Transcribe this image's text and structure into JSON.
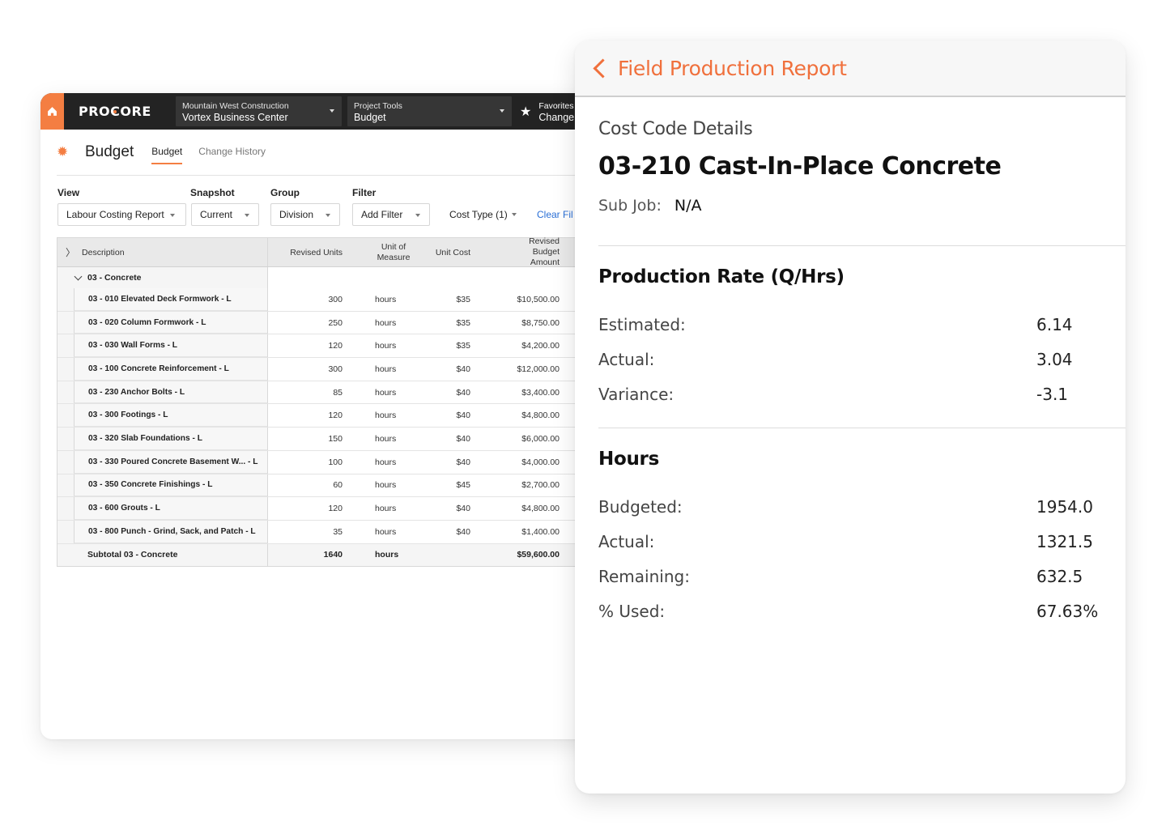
{
  "web": {
    "topbar": {
      "home_icon": "home-icon",
      "logo": "PROCORE",
      "company": {
        "label": "Mountain West Construction",
        "value": "Vortex Business Center"
      },
      "tools": {
        "label": "Project Tools",
        "value": "Budget"
      },
      "favorites": {
        "label": "Favorites",
        "value": "Change"
      }
    },
    "page": {
      "icon": "gear-icon",
      "title": "Budget",
      "tabs": [
        {
          "label": "Budget",
          "active": true
        },
        {
          "label": "Change History",
          "active": false
        }
      ]
    },
    "controls": {
      "view": {
        "label": "View",
        "value": "Labour Costing Report"
      },
      "snapshot": {
        "label": "Snapshot",
        "value": "Current"
      },
      "group": {
        "label": "Group",
        "value": "Division"
      },
      "filter": {
        "label": "Filter",
        "value": "Add Filter"
      },
      "cost_type": "Cost Type (1)",
      "clear_filters": "Clear Fil"
    },
    "table": {
      "headers": {
        "description": "Description",
        "revised_units": "Revised Units",
        "unit_of_measure": "Unit of Measure",
        "unit_cost": "Unit Cost",
        "revised_budget_amount": "Revised Budget Amount"
      },
      "group": "03 - Concrete",
      "rows": [
        {
          "description": "03 - 010 Elevated Deck Formwork - L",
          "units": "300",
          "uom": "hours",
          "unit_cost": "$35",
          "amount": "$10,500.00"
        },
        {
          "description": "03 - 020 Column Formwork - L",
          "units": "250",
          "uom": "hours",
          "unit_cost": "$35",
          "amount": "$8,750.00"
        },
        {
          "description": "03 - 030 Wall Forms - L",
          "units": "120",
          "uom": "hours",
          "unit_cost": "$35",
          "amount": "$4,200.00"
        },
        {
          "description": "03 - 100 Concrete Reinforcement - L",
          "units": "300",
          "uom": "hours",
          "unit_cost": "$40",
          "amount": "$12,000.00"
        },
        {
          "description": "03 - 230 Anchor Bolts - L",
          "units": "85",
          "uom": "hours",
          "unit_cost": "$40",
          "amount": "$3,400.00"
        },
        {
          "description": "03 - 300 Footings - L",
          "units": "120",
          "uom": "hours",
          "unit_cost": "$40",
          "amount": "$4,800.00"
        },
        {
          "description": "03 - 320 Slab Foundations - L",
          "units": "150",
          "uom": "hours",
          "unit_cost": "$40",
          "amount": "$6,000.00"
        },
        {
          "description": "03 - 330 Poured Concrete Basement W... - L",
          "units": "100",
          "uom": "hours",
          "unit_cost": "$40",
          "amount": "$4,000.00"
        },
        {
          "description": "03 - 350 Concrete Finishings - L",
          "units": "60",
          "uom": "hours",
          "unit_cost": "$45",
          "amount": "$2,700.00"
        },
        {
          "description": "03 - 600 Grouts - L",
          "units": "120",
          "uom": "hours",
          "unit_cost": "$40",
          "amount": "$4,800.00"
        },
        {
          "description": "03 - 800 Punch - Grind, Sack, and Patch - L",
          "units": "35",
          "uom": "hours",
          "unit_cost": "$40",
          "amount": "$1,400.00"
        }
      ],
      "subtotal": {
        "description": "Subtotal 03 - Concrete",
        "units": "1640",
        "uom": "hours",
        "unit_cost": "",
        "amount": "$59,600.00"
      }
    }
  },
  "mobile": {
    "nav": {
      "back_icon": "chevron-left-icon",
      "title": "Field Production Report"
    },
    "kicker": "Cost Code Details",
    "title": "03-210 Cast-In-Place Concrete",
    "sub_job": {
      "label": "Sub Job:",
      "value": "N/A"
    },
    "production_rate": {
      "heading": "Production Rate (Q/Hrs)",
      "rows": [
        {
          "label": "Estimated:",
          "value": "6.14"
        },
        {
          "label": "Actual:",
          "value": "3.04"
        },
        {
          "label": "Variance:",
          "value": "-3.1"
        }
      ]
    },
    "hours": {
      "heading": "Hours",
      "rows": [
        {
          "label": "Budgeted:",
          "value": "1954.0"
        },
        {
          "label": "Actual:",
          "value": "1321.5"
        },
        {
          "label": "Remaining:",
          "value": "632.5"
        },
        {
          "label": "% Used:",
          "value": "67.63%"
        }
      ]
    }
  },
  "colors": {
    "brand_orange": "#f47e42",
    "topbar": "#232323",
    "link_blue": "#2a6fd6"
  }
}
